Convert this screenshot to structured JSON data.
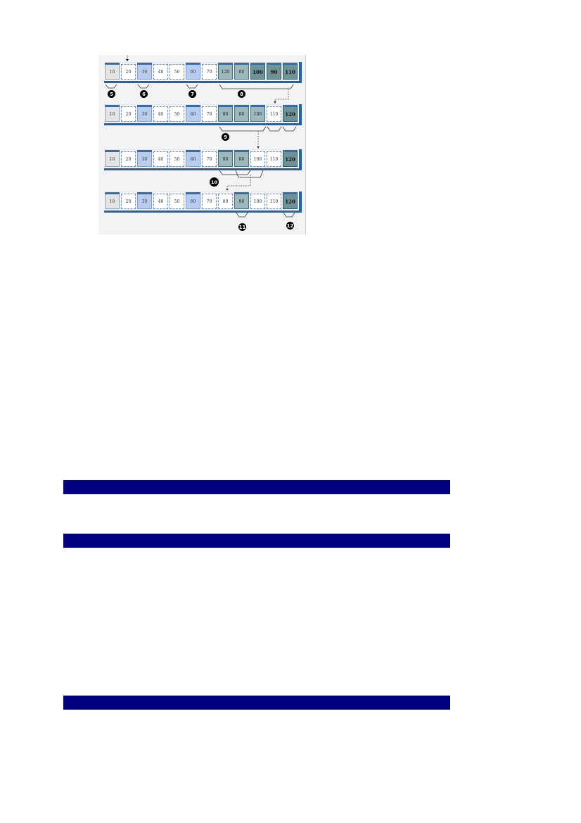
{
  "figure": {
    "rows": [
      {
        "cells": [
          {
            "value": "10",
            "style": "grey"
          },
          {
            "value": "20",
            "style": "plain"
          },
          {
            "value": "30",
            "style": "light"
          },
          {
            "value": "40",
            "style": "plain"
          },
          {
            "value": "50",
            "style": "plain"
          },
          {
            "value": "60",
            "style": "light"
          },
          {
            "value": "70",
            "style": "plain"
          },
          {
            "value": "120",
            "style": "teal"
          },
          {
            "value": "80",
            "style": "teal"
          },
          {
            "value": "100",
            "style": "dark"
          },
          {
            "value": "90",
            "style": "dark"
          },
          {
            "value": "110",
            "style": "dark"
          }
        ]
      },
      {
        "cells": [
          {
            "value": "10",
            "style": "grey"
          },
          {
            "value": "20",
            "style": "plain"
          },
          {
            "value": "30",
            "style": "light"
          },
          {
            "value": "40",
            "style": "plain"
          },
          {
            "value": "50",
            "style": "plain"
          },
          {
            "value": "60",
            "style": "light"
          },
          {
            "value": "70",
            "style": "plain"
          },
          {
            "value": "90",
            "style": "teal"
          },
          {
            "value": "80",
            "style": "teal"
          },
          {
            "value": "100",
            "style": "teal"
          },
          {
            "value": "110",
            "style": "plain"
          },
          {
            "value": "120",
            "style": "dark"
          }
        ]
      },
      {
        "cells": [
          {
            "value": "10",
            "style": "grey"
          },
          {
            "value": "20",
            "style": "plain"
          },
          {
            "value": "30",
            "style": "light"
          },
          {
            "value": "40",
            "style": "plain"
          },
          {
            "value": "50",
            "style": "plain"
          },
          {
            "value": "60",
            "style": "light"
          },
          {
            "value": "70",
            "style": "plain"
          },
          {
            "value": "90",
            "style": "teal"
          },
          {
            "value": "80",
            "style": "teal"
          },
          {
            "value": "100",
            "style": "plain"
          },
          {
            "value": "110",
            "style": "plain"
          },
          {
            "value": "120",
            "style": "dark"
          }
        ]
      },
      {
        "cells": [
          {
            "value": "10",
            "style": "grey"
          },
          {
            "value": "20",
            "style": "plain"
          },
          {
            "value": "30",
            "style": "light"
          },
          {
            "value": "40",
            "style": "plain"
          },
          {
            "value": "50",
            "style": "plain"
          },
          {
            "value": "60",
            "style": "light"
          },
          {
            "value": "70",
            "style": "plain"
          },
          {
            "value": "80",
            "style": "plain"
          },
          {
            "value": "90",
            "style": "teal"
          },
          {
            "value": "100",
            "style": "plain"
          },
          {
            "value": "110",
            "style": "plain"
          },
          {
            "value": "120",
            "style": "dark"
          }
        ]
      }
    ],
    "markers": [
      "5",
      "6",
      "7",
      "8",
      "9",
      "10",
      "11",
      "12"
    ]
  },
  "colors": {
    "section_bar": "#000080",
    "row_base": "#1f63a8"
  }
}
